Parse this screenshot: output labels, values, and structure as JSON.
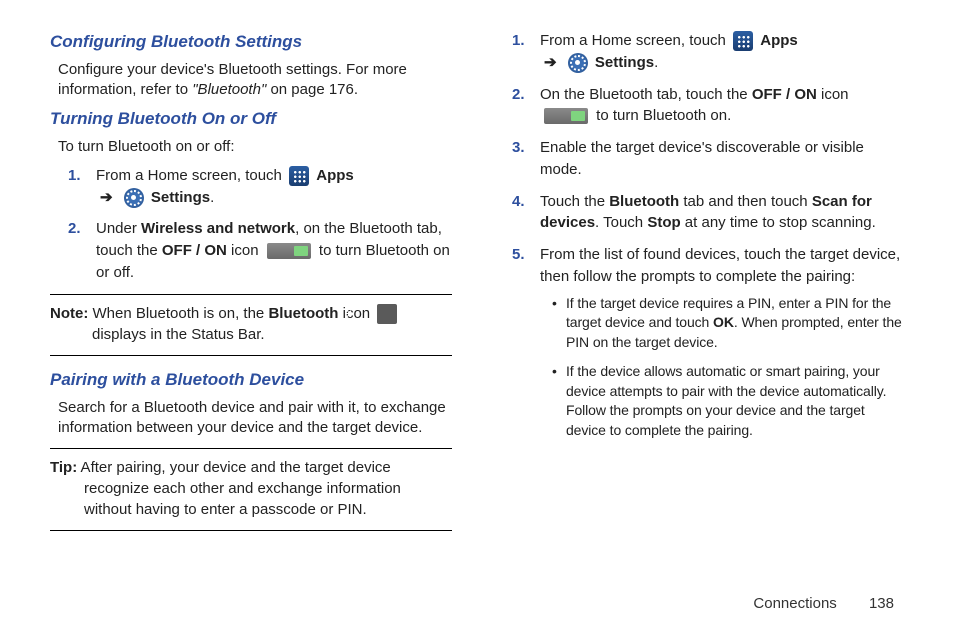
{
  "left": {
    "h1": "Configuring Bluetooth Settings",
    "p1a": "Configure your device's Bluetooth settings. For more information, refer to ",
    "p1b": "\"Bluetooth\"",
    "p1c": "  on page 176.",
    "h2": "Turning Bluetooth On or Off",
    "p2": "To turn Bluetooth on or off:",
    "step1a": "From a Home screen, touch ",
    "apps": "Apps",
    "settings": "Settings",
    "step2a": "Under ",
    "step2b": "Wireless and network",
    "step2c": ", on the Bluetooth tab, touch the ",
    "step2d": "OFF / ON",
    "step2e": " icon ",
    "step2f": " to turn Bluetooth on or off.",
    "noteLabel": "Note:",
    "note1": " When Bluetooth is on, the ",
    "note2": "Bluetooth",
    "note3": " icon ",
    "note4": " displays in the Status Bar.",
    "h3": "Pairing with a Bluetooth Device",
    "p3": "Search for a Bluetooth device and pair with it, to exchange information between your device and the target device.",
    "tipLabel": "Tip:",
    "tip": " After pairing, your device and the target device recognize each other and exchange information without having to enter a passcode or PIN."
  },
  "right": {
    "step1a": "From a Home screen, touch ",
    "apps": "Apps",
    "settings": "Settings",
    "step2a": "On the Bluetooth tab, touch the ",
    "step2b": "OFF / ON",
    "step2c": " icon ",
    "step2d": " to turn Bluetooth on.",
    "step3": "Enable the target device's discoverable or visible mode.",
    "step4a": "Touch the ",
    "step4b": "Bluetooth",
    "step4c": " tab and then touch ",
    "step4d": "Scan for devices",
    "step4e": ". Touch ",
    "step4f": "Stop",
    "step4g": " at any time to stop scanning.",
    "step5": "From the list of found devices, touch the target device, then follow the prompts to complete the pairing:",
    "sub1a": "If the target device requires a PIN, enter a PIN for the target device and touch ",
    "sub1b": "OK",
    "sub1c": ". When prompted, enter the PIN on the target device.",
    "sub2": "If the device allows automatic or smart pairing, your device attempts to pair with the device automatically. Follow the prompts on your device and the target device to complete the pairing."
  },
  "footer": {
    "section": "Connections",
    "page": "138"
  },
  "arrow": "➔",
  "period": "."
}
